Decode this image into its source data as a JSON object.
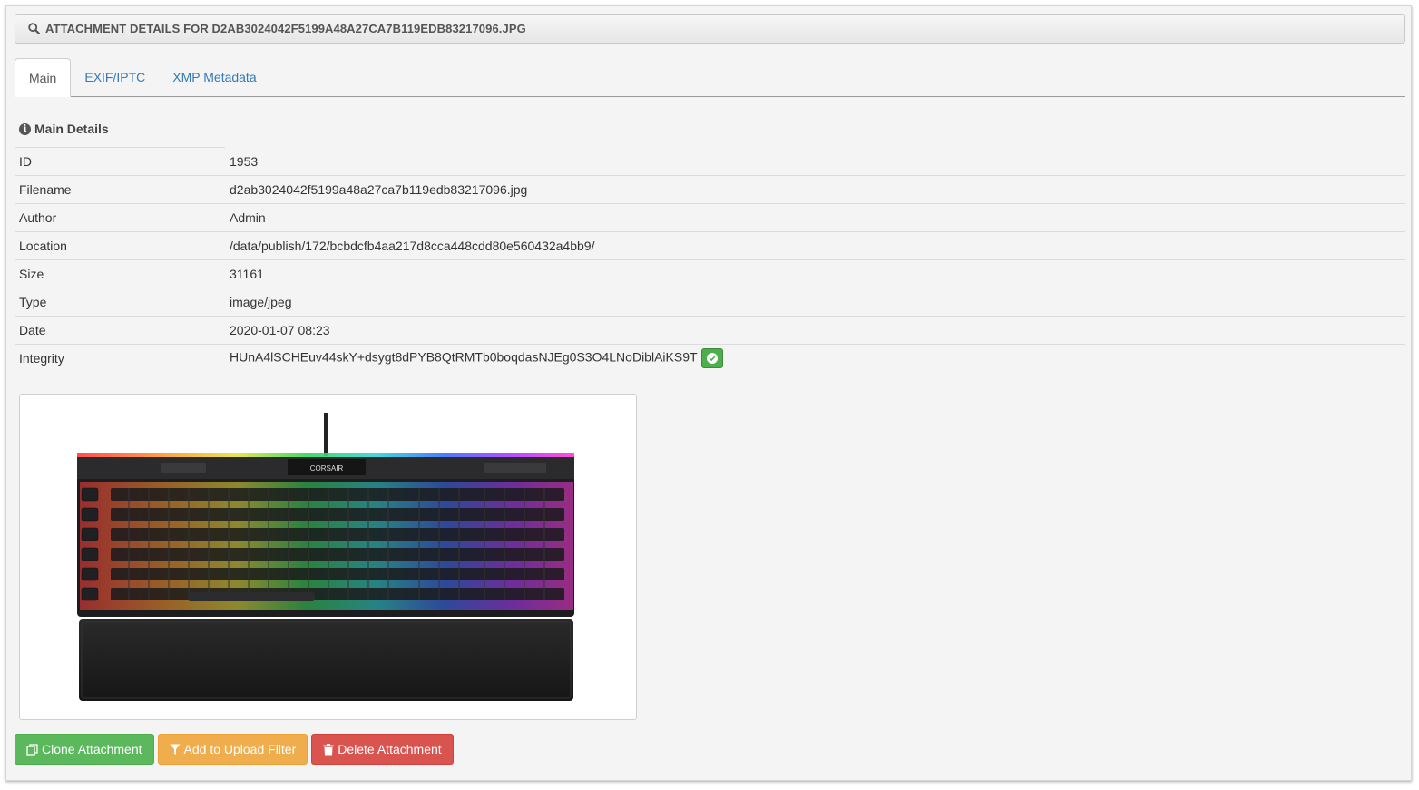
{
  "header": {
    "title": "ATTACHMENT DETAILS FOR D2AB3024042F5199A48A27CA7B119EDB83217096.JPG",
    "icon": "search-icon"
  },
  "tabs": [
    {
      "label": "Main",
      "active": true
    },
    {
      "label": "EXIF/IPTC",
      "active": false
    },
    {
      "label": "XMP Metadata",
      "active": false
    }
  ],
  "section": {
    "title": "Main Details",
    "icon": "info-icon"
  },
  "details": [
    {
      "label": "ID",
      "value": "1953"
    },
    {
      "label": "Filename",
      "value": "d2ab3024042f5199a48a27ca7b119edb83217096.jpg"
    },
    {
      "label": "Author",
      "value": "Admin"
    },
    {
      "label": "Location",
      "value": "/data/publish/172/bcbdcfb4aa217d8cca448cdd80e560432a4bb9/"
    },
    {
      "label": "Size",
      "value": "31161"
    },
    {
      "label": "Type",
      "value": "image/jpeg"
    },
    {
      "label": "Date",
      "value": "2020-01-07 08:23"
    },
    {
      "label": "Integrity",
      "value": "HUnA4lSCHEuv44skY+dsygt8dPYB8QtRMTb0boqdasNJEg0S3O4LNoDiblAiKS9T"
    }
  ],
  "preview": {
    "brand_text": "CORSAIR",
    "icon": "keyboard-image"
  },
  "actions": {
    "clone": "Clone Attachment",
    "filter": "Add to Upload Filter",
    "delete": "Delete Attachment"
  },
  "colors": {
    "link": "#337ab7",
    "success": "#5cb85c",
    "warning": "#f0ad4e",
    "danger": "#d9534f"
  }
}
